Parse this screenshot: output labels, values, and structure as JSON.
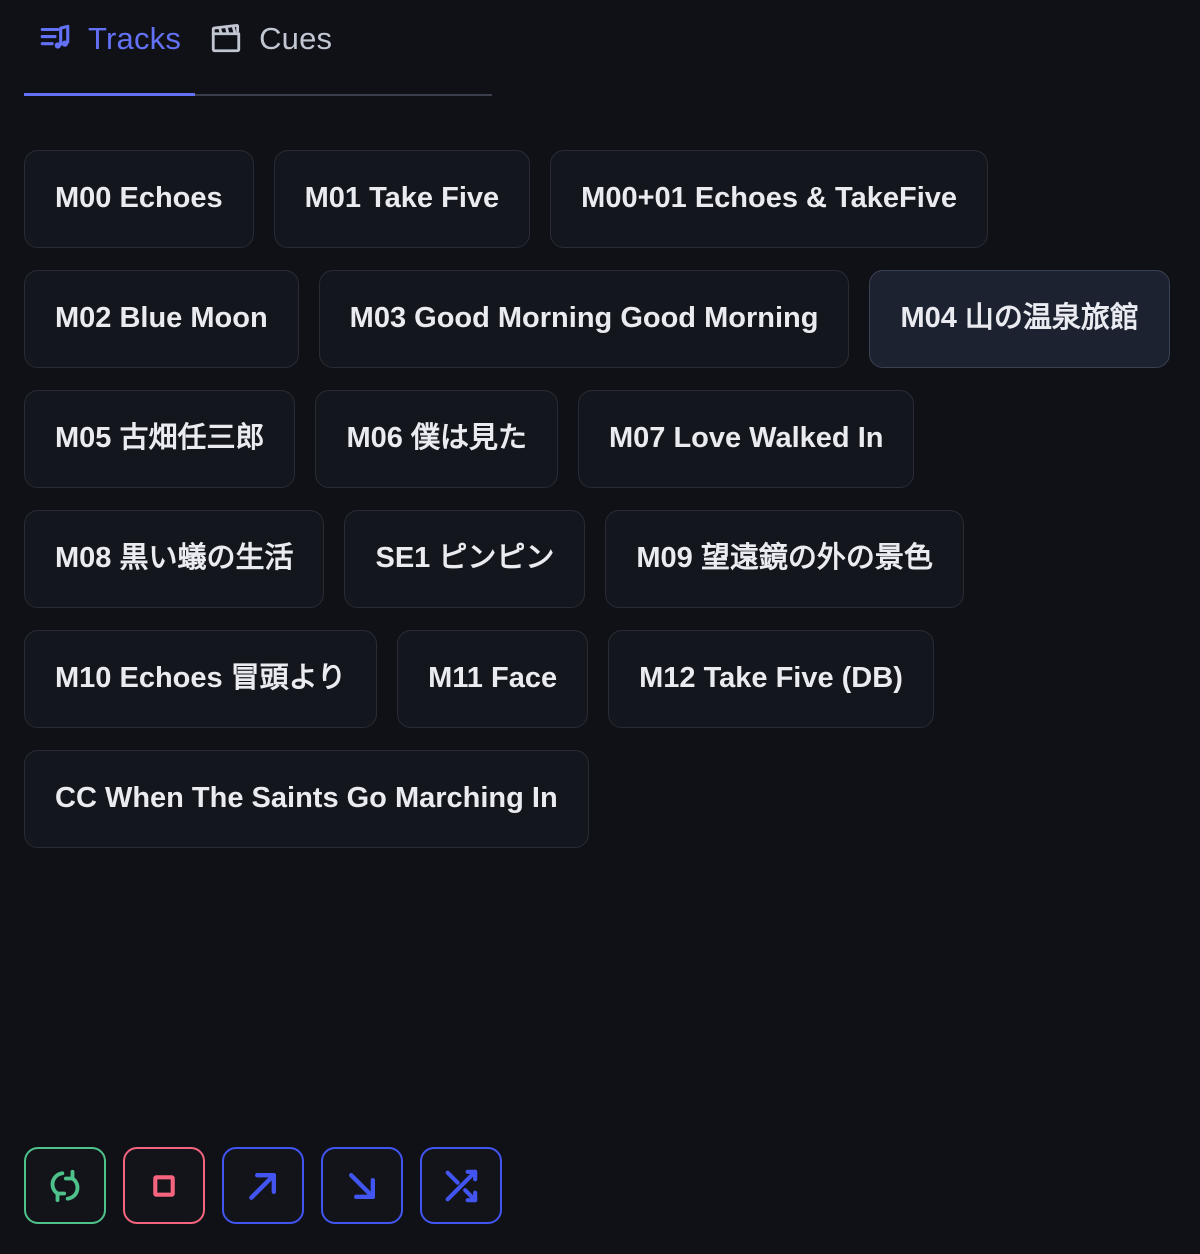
{
  "theme": {
    "background": "#0f1116",
    "button_bg": "#14161d",
    "button_border": "#282c36",
    "selected_bg": "#1d2230",
    "text": "#e9ebf0",
    "accent_indigo": "#6371f6",
    "accent_green": "#4ec28a",
    "accent_red": "#f4647e",
    "accent_blue": "#4355f0",
    "tab_inactive": "#c1c6d2",
    "tab_divider": "#3a3f4b"
  },
  "tabs": [
    {
      "label": "Tracks",
      "icon": "list-music-icon",
      "active": true
    },
    {
      "label": "Cues",
      "icon": "clapperboard-icon",
      "active": false
    }
  ],
  "tracks": [
    {
      "label": "M00 Echoes",
      "selected": false
    },
    {
      "label": "M01 Take Five",
      "selected": false
    },
    {
      "label": "M00+01 Echoes & TakeFive",
      "selected": false
    },
    {
      "label": "M02 Blue Moon",
      "selected": false
    },
    {
      "label": "M03 Good Morning Good Morning",
      "selected": false
    },
    {
      "label": "M04 山の温泉旅館",
      "selected": true
    },
    {
      "label": "M05 古畑任三郎",
      "selected": false
    },
    {
      "label": "M06 僕は見た",
      "selected": false
    },
    {
      "label": "M07 Love Walked In",
      "selected": false
    },
    {
      "label": "M08 黒い蟻の生活",
      "selected": false
    },
    {
      "label": "SE1 ピンピン",
      "selected": false
    },
    {
      "label": "M09 望遠鏡の外の景色",
      "selected": false
    },
    {
      "label": "M10 Echoes 冒頭より",
      "selected": false
    },
    {
      "label": "M11 Face",
      "selected": false
    },
    {
      "label": "M12 Take Five (DB)",
      "selected": false
    },
    {
      "label": "CC When The Saints Go Marching In",
      "selected": false
    }
  ],
  "controls": [
    {
      "name": "loop-button",
      "icon": "repeat-icon",
      "color": "green"
    },
    {
      "name": "stop-button",
      "icon": "stop-square-icon",
      "color": "red"
    },
    {
      "name": "fade-in-button",
      "icon": "arrow-up-right-icon",
      "color": "blue"
    },
    {
      "name": "fade-out-button",
      "icon": "arrow-down-right-icon",
      "color": "blue"
    },
    {
      "name": "shuffle-button",
      "icon": "shuffle-icon",
      "color": "blue"
    }
  ]
}
